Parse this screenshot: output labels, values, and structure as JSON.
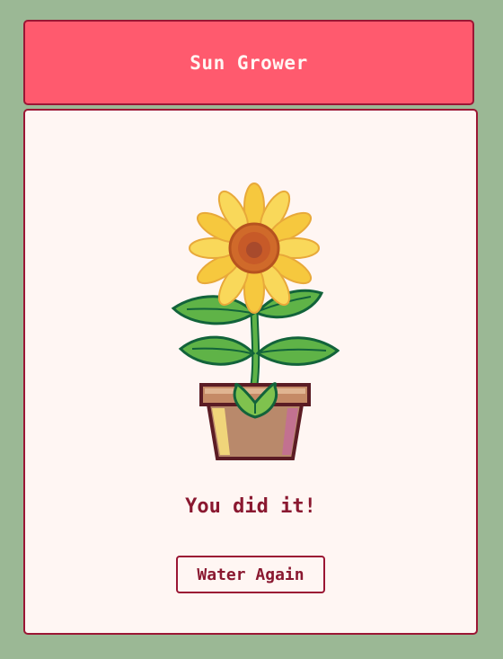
{
  "header": {
    "title": "Sun Grower"
  },
  "main": {
    "message": "You did it!",
    "water_button_label": "Water Again",
    "illustration": "potted-sunflower"
  },
  "colors": {
    "background": "#9bb895",
    "header": "#ff5a6e",
    "border": "#9b1634",
    "card": "#fff6f3",
    "text": "#8a1830"
  }
}
